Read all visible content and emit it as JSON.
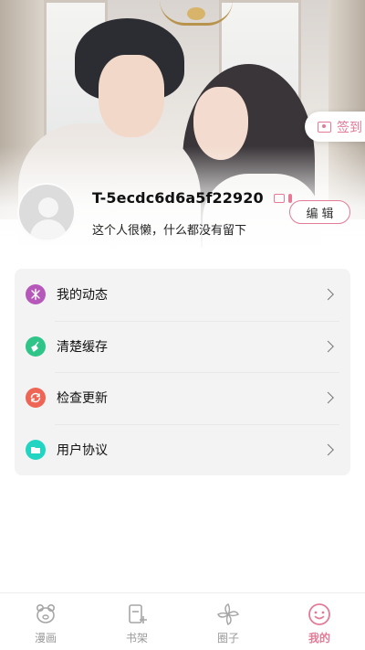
{
  "header": {
    "signin_label": "签到"
  },
  "profile": {
    "username": "T-5ecdc6d6a5f22920",
    "bio": "这个人很懒，什么都没有留下",
    "edit_label": "编辑"
  },
  "menu": {
    "items": [
      {
        "label": "我的动态",
        "icon": "activity-icon",
        "color": "#b558b9"
      },
      {
        "label": "清楚缓存",
        "icon": "broom-icon",
        "color": "#2fc589"
      },
      {
        "label": "检查更新",
        "icon": "refresh-icon",
        "color": "#ef6555"
      },
      {
        "label": "用户协议",
        "icon": "folder-icon",
        "color": "#22d5c2"
      }
    ]
  },
  "tabbar": {
    "items": [
      {
        "label": "漫画",
        "icon": "bear-icon",
        "active": false
      },
      {
        "label": "书架",
        "icon": "bookshelf-icon",
        "active": false
      },
      {
        "label": "圈子",
        "icon": "pinwheel-icon",
        "active": false
      },
      {
        "label": "我的",
        "icon": "smiley-icon",
        "active": true
      }
    ],
    "active_color": "#e27b98",
    "inactive_color": "#9a9a9a"
  }
}
